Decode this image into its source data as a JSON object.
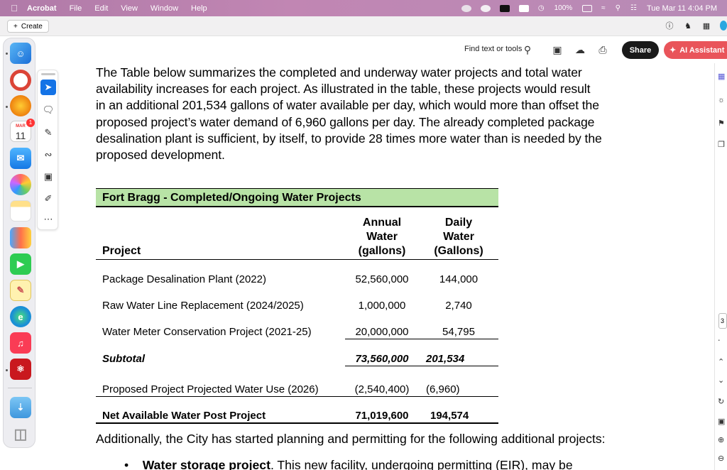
{
  "menubar": {
    "app": "Acrobat",
    "items": [
      "File",
      "Edit",
      "View",
      "Window",
      "Help"
    ],
    "battery": "100%",
    "clock": "Tue Mar 11  4:04 PM"
  },
  "createbar": {
    "create_label": "Create"
  },
  "toolbar": {
    "find_label": "Find text or tools",
    "share_label": "Share",
    "ai_label": "AI Assistant"
  },
  "dock": {
    "calendar_month": "MAR",
    "calendar_day": "11",
    "calendar_badge": "1"
  },
  "document": {
    "paragraph_lines": [
      "The Table below summarizes the completed and underway water projects and total water",
      "availability increases for each project. As illustrated in the table, these projects would result",
      "in an additional 201,534 gallons of water available per day, which would more than offset the",
      "proposed project’s water demand of 6,960 gallons per day. The already completed package",
      "desalination plant is sufficient, by itself, to provide 28 times more water than is needed by the",
      "proposed development."
    ],
    "table": {
      "title": "Fort Bragg - Completed/Ongoing Water Projects",
      "col_project": "Project",
      "col_annual_lines": [
        "Annual",
        "Water",
        "(gallons)"
      ],
      "col_daily_lines": [
        "Daily",
        "Water",
        "(Gallons)"
      ],
      "rows": [
        {
          "project": "Package Desalination Plant (2022)",
          "annual": "52,560,000",
          "daily": "144,000"
        },
        {
          "project": "Raw Water Line Replacement (2024/2025)",
          "annual": "1,000,000",
          "daily": "2,740"
        },
        {
          "project": "Water Meter Conservation Project (2021-25)",
          "annual": "20,000,000",
          "daily": "54,795"
        }
      ],
      "subtotal": {
        "label": "Subtotal",
        "annual": "73,560,000",
        "daily": "201,534"
      },
      "proposed": {
        "label": "Proposed Project Projected Water Use (2026)",
        "annual": "(2,540,400)",
        "daily": "(6,960)"
      },
      "net": {
        "label": "Net Available Water Post Project",
        "annual": "71,019,600",
        "daily": "194,574"
      }
    },
    "after_text": "Additionally, the City has started planning and permitting for the following additional projects:",
    "bullet_bold": "Water storage project",
    "bullet_rest": ". This new facility, undergoing permitting (EIR), may be"
  },
  "rightrail": {
    "page_number": "3"
  },
  "colors": {
    "menubar": "#b07aa8",
    "table_header": "#b8e3a6",
    "ai_button": "#e9545a",
    "active_tool": "#1473e6"
  }
}
